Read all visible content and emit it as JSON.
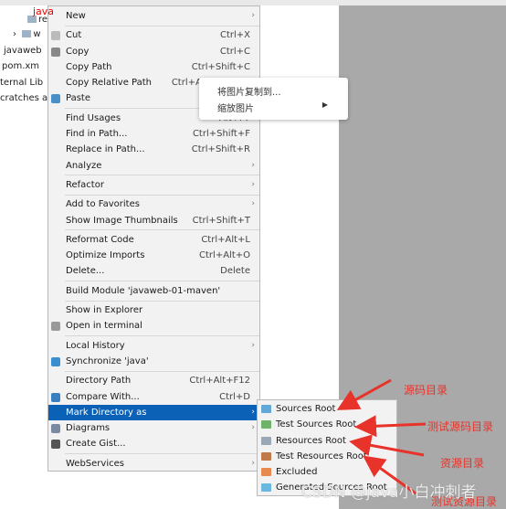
{
  "tree": {
    "highlight_label": "java",
    "items": [
      "re",
      "w",
      "javaweb",
      "pom.xm",
      "ternal Lib",
      "cratches a"
    ]
  },
  "menu": {
    "groups": [
      [
        {
          "label": "New",
          "submenu": true
        }
      ],
      [
        {
          "label": "Cut",
          "shortcut": "Ctrl+X",
          "icon": "cut-icon"
        },
        {
          "label": "Copy",
          "shortcut": "Ctrl+C",
          "icon": "copy-icon"
        },
        {
          "label": "Copy Path",
          "shortcut": "Ctrl+Shift+C"
        },
        {
          "label": "Copy Relative Path",
          "shortcut": "Ctrl+Alt+Shift+C"
        },
        {
          "label": "Paste",
          "shortcut": "Ctrl+V",
          "icon": "paste-icon"
        }
      ],
      [
        {
          "label": "Find Usages",
          "shortcut": "Alt+F7"
        },
        {
          "label": "Find in Path...",
          "shortcut": "Ctrl+Shift+F"
        },
        {
          "label": "Replace in Path...",
          "shortcut": "Ctrl+Shift+R"
        },
        {
          "label": "Analyze",
          "submenu": true
        }
      ],
      [
        {
          "label": "Refactor",
          "submenu": true
        }
      ],
      [
        {
          "label": "Add to Favorites",
          "submenu": true
        },
        {
          "label": "Show Image Thumbnails",
          "shortcut": "Ctrl+Shift+T"
        }
      ],
      [
        {
          "label": "Reformat Code",
          "shortcut": "Ctrl+Alt+L"
        },
        {
          "label": "Optimize Imports",
          "shortcut": "Ctrl+Alt+O"
        },
        {
          "label": "Delete...",
          "shortcut": "Delete"
        }
      ],
      [
        {
          "label": "Build Module 'javaweb-01-maven'"
        }
      ],
      [
        {
          "label": "Show in Explorer"
        },
        {
          "label": "Open in terminal",
          "icon": "terminal-icon"
        }
      ],
      [
        {
          "label": "Local History",
          "submenu": true
        },
        {
          "label": "Synchronize 'java'",
          "icon": "sync-icon"
        }
      ],
      [
        {
          "label": "Directory Path",
          "shortcut": "Ctrl+Alt+F12"
        },
        {
          "label": "Compare With...",
          "shortcut": "Ctrl+D",
          "icon": "compare-icon"
        },
        {
          "label": "Mark Directory as",
          "submenu": true,
          "highlighted": true
        },
        {
          "label": "Diagrams",
          "submenu": true,
          "icon": "diagram-icon"
        },
        {
          "label": "Create Gist...",
          "icon": "github-icon"
        }
      ],
      [
        {
          "label": "WebServices",
          "submenu": true
        }
      ]
    ]
  },
  "image_popup": {
    "items": [
      "将图片复制到...",
      "缩放图片"
    ]
  },
  "submenu": {
    "items": [
      {
        "label": "Sources Root",
        "color": "#5fa8d8"
      },
      {
        "label": "Test Sources Root",
        "color": "#6db36a"
      },
      {
        "label": "Resources Root",
        "color": "#9aa7b4"
      },
      {
        "label": "Test Resources Root",
        "color": "#c07a4a"
      },
      {
        "label": "Excluded",
        "color": "#e8894f"
      },
      {
        "label": "Generated Sources Root",
        "color": "#6ab8e0"
      }
    ]
  },
  "annotations": [
    "源码目录",
    "测试源码目录",
    "资源目录",
    "测试资源目录"
  ],
  "watermark": "CSDN @java小白冲刺者",
  "colors": {
    "highlight": "#0b61b5",
    "annotation": "#e8332a"
  }
}
